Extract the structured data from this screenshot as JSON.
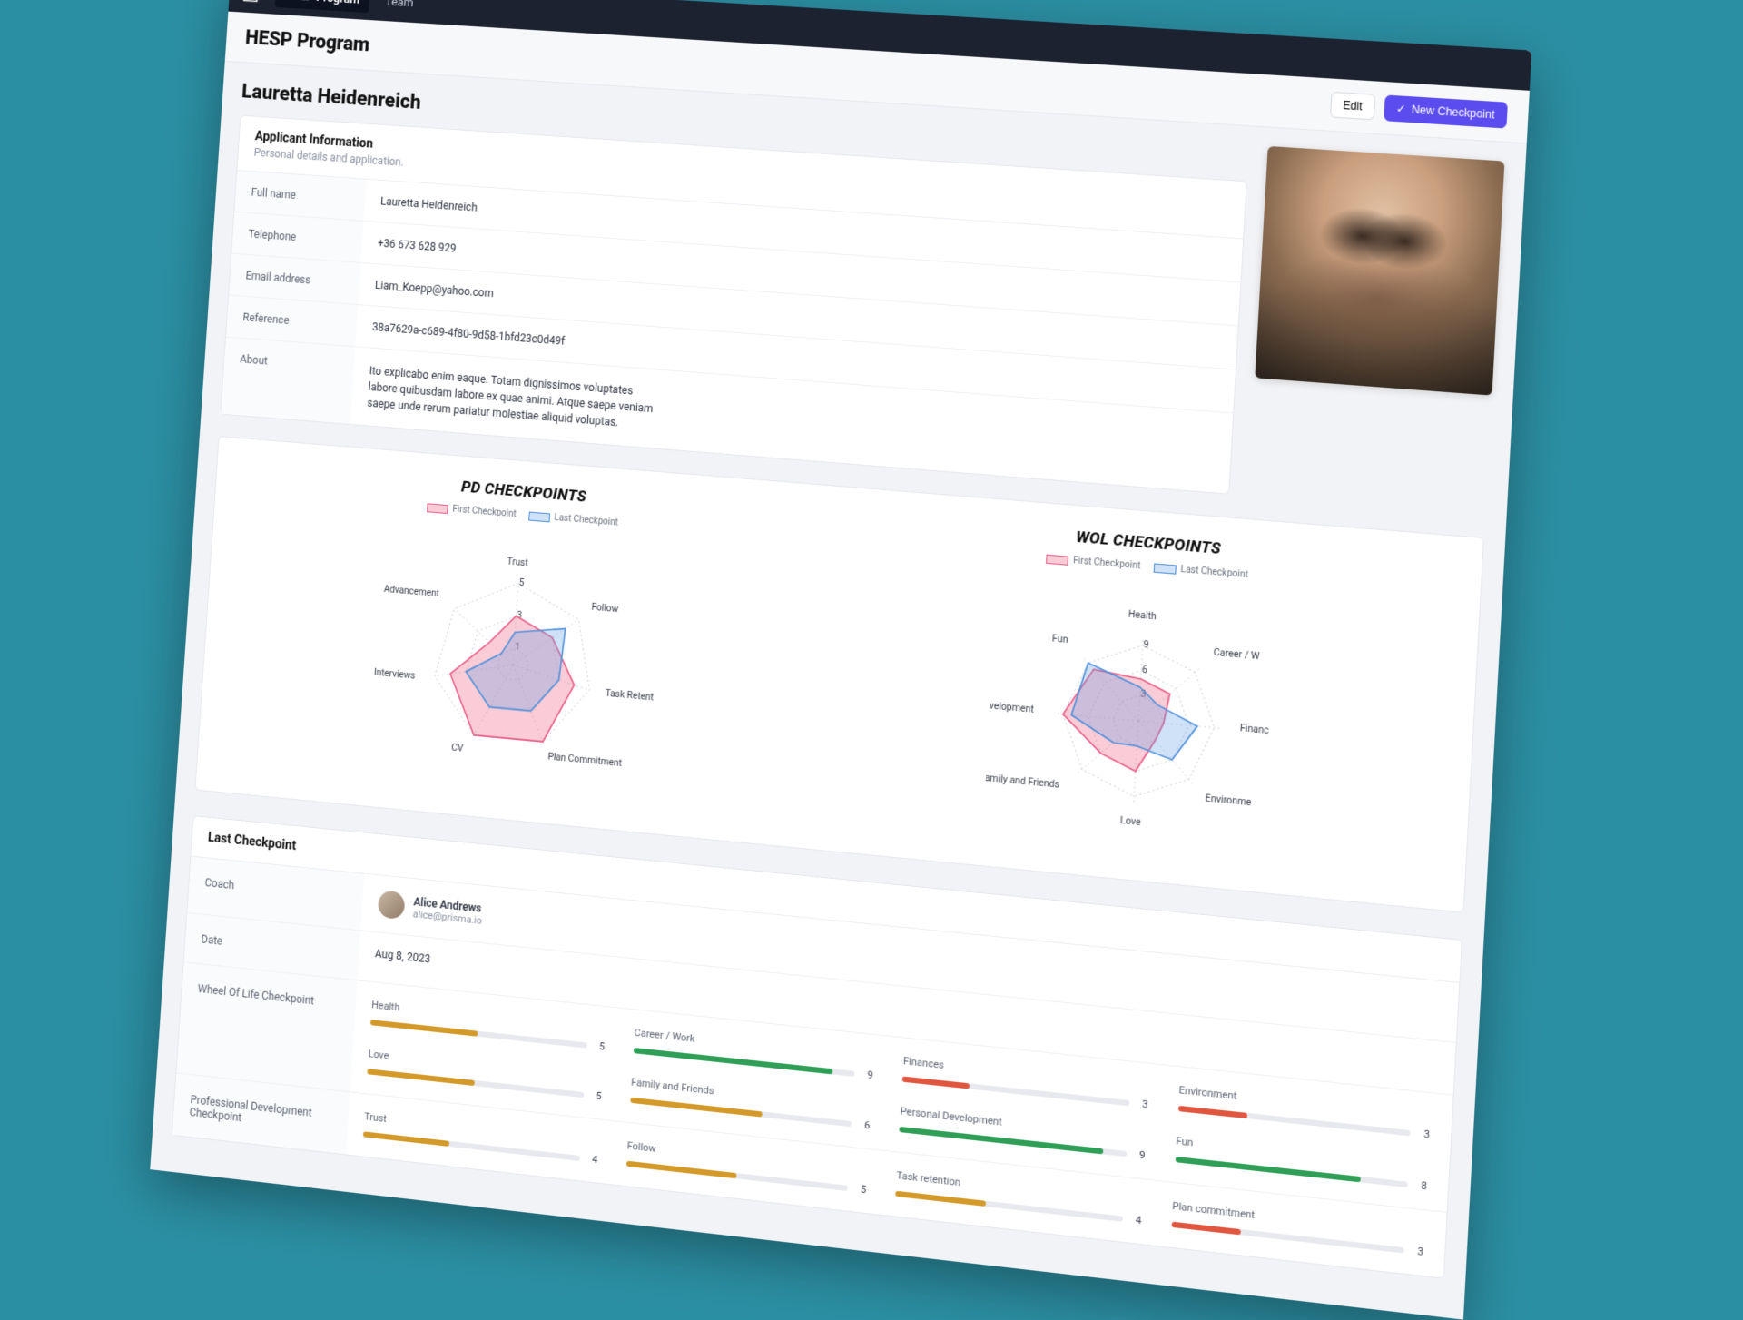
{
  "nav": {
    "items": [
      "HELP Program",
      "Team"
    ],
    "activeIndex": 0
  },
  "page": {
    "title": "HESP Program",
    "edit_label": "Edit",
    "new_checkpoint_label": "New Checkpoint"
  },
  "profile": {
    "name": "Lauretta Heidenreich",
    "section_title": "Applicant Information",
    "section_sub": "Personal details and application.",
    "fields": [
      {
        "label": "Full name",
        "value": "Lauretta Heidenreich"
      },
      {
        "label": "Telephone",
        "value": "+36 673 628 929"
      },
      {
        "label": "Email address",
        "value": "Liam_Koepp@yahoo.com"
      },
      {
        "label": "Reference",
        "value": "38a7629a-c689-4f80-9d58-1bfd23c0d49f"
      },
      {
        "label": "About",
        "value": "Ito explicabo enim eaque. Totam dignissimos voluptates labore quibusdam labore ex quae animi. Atque saepe veniam saepe unde rerum pariatur molestiae aliquid voluptas."
      }
    ]
  },
  "legend": {
    "first": "First Checkpoint",
    "last": "Last Checkpoint"
  },
  "chart_data": [
    {
      "type": "radar",
      "title": "PD CHECKPOINTS",
      "categories": [
        "Trust",
        "Follow",
        "Task Retention",
        "Plan Commitment",
        "CV",
        "Interviews",
        "Advancement"
      ],
      "scale": {
        "min": 0,
        "max": 5,
        "ticks": [
          1,
          3,
          5
        ]
      },
      "series": [
        {
          "name": "First Checkpoint",
          "color": "#e85c86",
          "fill": "rgba(240,110,140,0.35)",
          "values": [
            3,
            3,
            4,
            5,
            5,
            4,
            2
          ]
        },
        {
          "name": "Last Checkpoint",
          "color": "#4f8fd9",
          "fill": "rgba(100,160,230,0.30)",
          "values": [
            2,
            4,
            3,
            3,
            3,
            3,
            1
          ]
        }
      ]
    },
    {
      "type": "radar",
      "title": "WOL CHECKPOINTS",
      "categories": [
        "Health",
        "Career / Work",
        "Finances",
        "Environment",
        "Love",
        "Family and Friends",
        "Personal Development",
        "Fun"
      ],
      "labels_display": [
        "Health",
        "Career / W",
        "Financ",
        "Environme",
        "Love",
        "Family and Friends",
        "rsonal Development",
        "Fun"
      ],
      "scale": {
        "min": 0,
        "max": 10,
        "ticks": [
          3,
          6,
          9
        ]
      },
      "series": [
        {
          "name": "First Checkpoint",
          "color": "#e85c86",
          "fill": "rgba(240,110,140,0.35)",
          "values": [
            5,
            5,
            3,
            3,
            6,
            6,
            9,
            8
          ]
        },
        {
          "name": "Last Checkpoint",
          "color": "#4f8fd9",
          "fill": "rgba(100,160,230,0.30)",
          "values": [
            4,
            3,
            7,
            6,
            3,
            4,
            8,
            9
          ]
        }
      ]
    }
  ],
  "last_checkpoint": {
    "section_title": "Last Checkpoint",
    "coach_label": "Coach",
    "coach": {
      "name": "Alice Andrews",
      "email": "alice@prisma.io"
    },
    "date_label": "Date",
    "date": "Aug 8, 2023",
    "wol_label": "Wheel Of Life Checkpoint",
    "wol_bars": [
      {
        "label": "Health",
        "value": 5,
        "color": "#d39a2a"
      },
      {
        "label": "Career / Work",
        "value": 9,
        "color": "#2f9e56"
      },
      {
        "label": "Finances",
        "value": 3,
        "color": "#e0563f"
      },
      {
        "label": "Environment",
        "value": 3,
        "color": "#e0563f"
      },
      {
        "label": "Love",
        "value": 5,
        "color": "#d39a2a"
      },
      {
        "label": "Family and Friends",
        "value": 6,
        "color": "#d39a2a"
      },
      {
        "label": "Personal Development",
        "value": 9,
        "color": "#2f9e56"
      },
      {
        "label": "Fun",
        "value": 8,
        "color": "#2f9e56"
      }
    ],
    "pd_label": "Professional Development Checkpoint",
    "pd_bars": [
      {
        "label": "Trust",
        "value": 4,
        "color": "#d39a2a"
      },
      {
        "label": "Follow",
        "value": 5,
        "color": "#d39a2a"
      },
      {
        "label": "Task retention",
        "value": 4,
        "color": "#d39a2a"
      },
      {
        "label": "Plan commitment",
        "value": 3,
        "color": "#e0563f"
      }
    ],
    "bar_max": 10
  }
}
